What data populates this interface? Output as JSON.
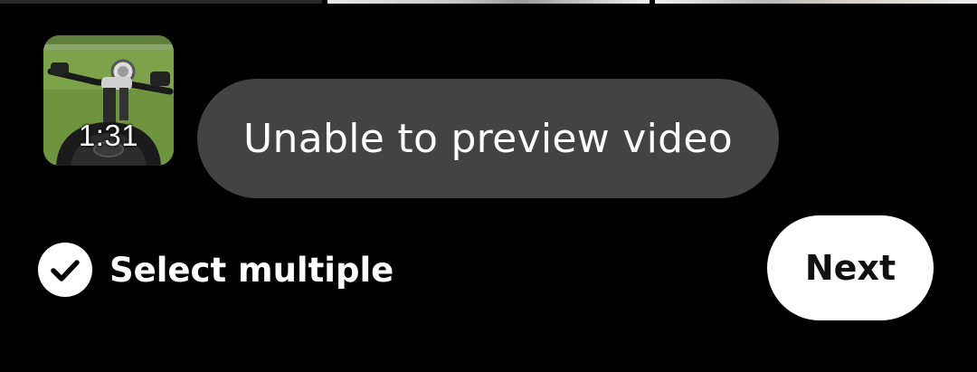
{
  "video": {
    "duration": "1:31"
  },
  "toast": {
    "message": "Unable to preview video"
  },
  "footer": {
    "select_multiple_label": "Select multiple",
    "next_label": "Next"
  }
}
